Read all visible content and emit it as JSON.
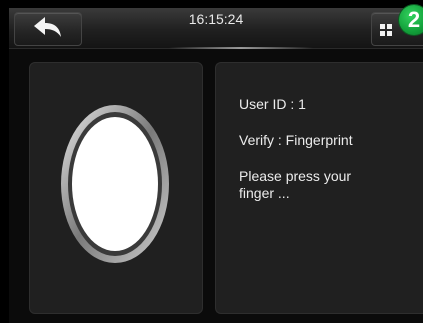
{
  "status_bar": {
    "time": "16:15:24",
    "back_icon": "back-arrow-icon",
    "menu_icon": "grid-menu-icon",
    "notification_count": "2"
  },
  "verify": {
    "user_id_text": "User ID : 1",
    "verify_mode_text": "Verify : Fingerprint",
    "prompt_text": "Please press your\nfinger ...",
    "fingerprint_icon": "fingerprint-placeholder-icon"
  },
  "colors": {
    "background": "#000000",
    "panel": "#202020",
    "badge": "#12a03a",
    "text": "#ececec"
  }
}
